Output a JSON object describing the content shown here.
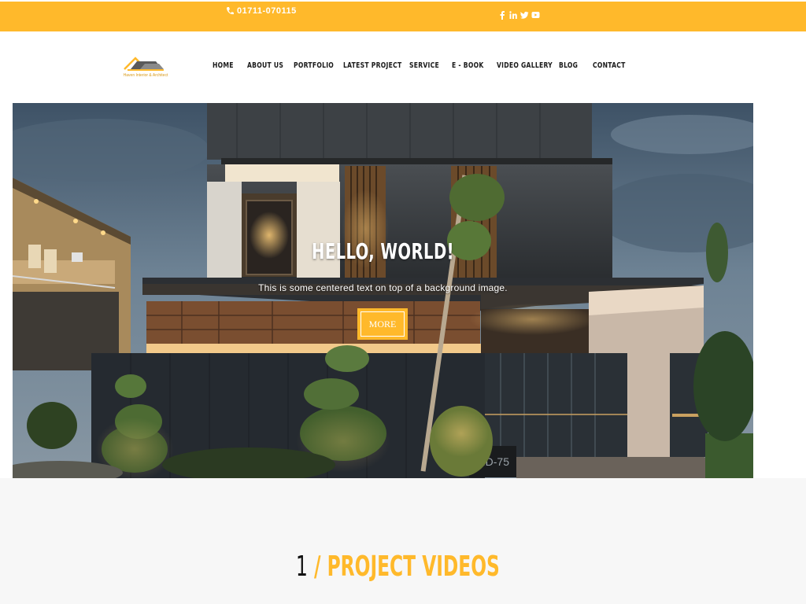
{
  "topbar": {
    "phone": "01711-070115",
    "social_icons": [
      "facebook-icon",
      "linkedin-icon",
      "twitter-icon",
      "youtube-icon"
    ],
    "color": "#ffb92b"
  },
  "logo": {
    "brand_text": "Haven Interior & Architect"
  },
  "nav": {
    "items": [
      "HOME",
      "ABOUT US",
      "PORTFOLIO",
      "LATEST PROJECT",
      "SERVICE",
      "E - BOOK",
      "VIDEO GALLERY",
      "BLOG",
      "CONTACT"
    ]
  },
  "hero": {
    "title": "HELLO, WORLD!",
    "subtitle": "This is some centered text on top of a background image.",
    "button_label": "MORE",
    "house_plate": "MD-75"
  },
  "section": {
    "number": "1",
    "title": "/ PROJECT VIDEOS"
  }
}
